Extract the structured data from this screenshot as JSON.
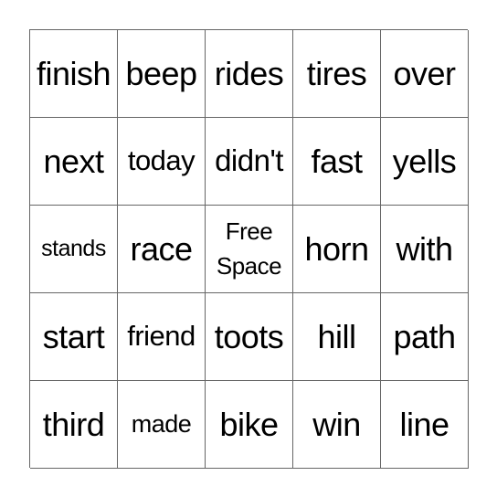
{
  "card": {
    "cells": [
      [
        "finish",
        "beep",
        "rides",
        "tires",
        "over"
      ],
      [
        "next",
        "today",
        "didn't",
        "fast",
        "yells"
      ],
      [
        "stands",
        "race",
        "Free Space",
        "horn",
        "with"
      ],
      [
        "start",
        "friend",
        "toots",
        "hill",
        "path"
      ],
      [
        "third",
        "made",
        "bike",
        "win",
        "line"
      ]
    ],
    "free_space": "Free Space"
  }
}
